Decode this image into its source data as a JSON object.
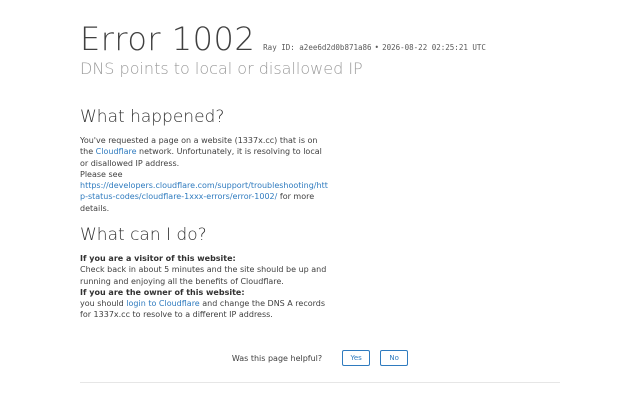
{
  "error": {
    "title": "Error 1002",
    "ray_label": "Ray ID:",
    "ray_id": "a2ee6d2d0b871a86",
    "separator": "•",
    "timestamp": "2026-08-22 02:25:21 UTC",
    "subtitle": "DNS points to local or disallowed IP"
  },
  "what_happened": {
    "heading": "What happened?",
    "p1_before": "You've requested a page on a website (1337x.cc) that is on the ",
    "p1_link": "Cloudflare",
    "p1_after": " network. Unfortunately, it is resolving to local or disallowed IP address.",
    "please_see": "Please see",
    "doc_link": "https://developers.cloudflare.com/support/troubleshooting/http-status-codes/cloudflare-1xxx-errors/error-1002/",
    "doc_after": " for more details."
  },
  "what_can_i_do": {
    "heading": "What can I do?",
    "visitor_heading": "If you are a visitor of this website:",
    "visitor_text": "Check back in about 5 minutes and the site should be up and running and enjoying all the benefits of Cloudflare.",
    "owner_heading": "If you are the owner of this website:",
    "owner_before": "you should ",
    "owner_link": "login to Cloudflare",
    "owner_after": " and change the DNS A records for 1337x.cc to resolve to a different IP address."
  },
  "feedback": {
    "question": "Was this page helpful?",
    "yes_label": "Yes",
    "no_label": "No"
  },
  "colors": {
    "link": "#2f7bbf",
    "text": "#404040",
    "subtitle": "#9a9a9a"
  }
}
